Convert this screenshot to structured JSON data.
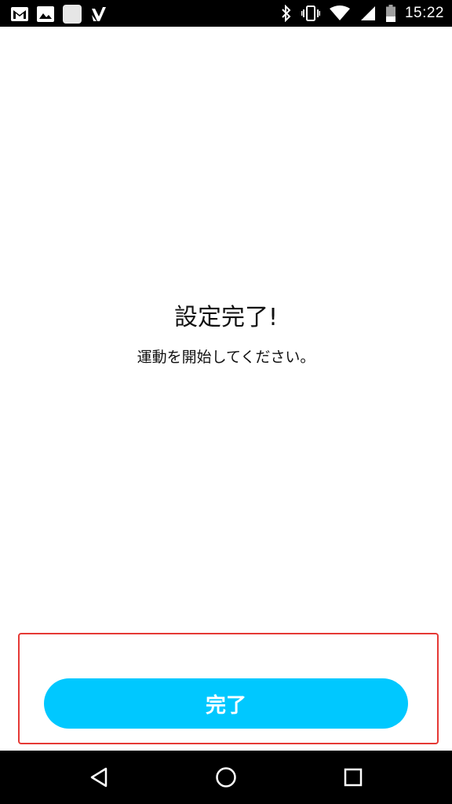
{
  "status_bar": {
    "time": "15:22",
    "left_icons": [
      "gmail-icon",
      "gallery-icon",
      "square-app-icon",
      "check-app-icon"
    ],
    "right_icons": [
      "bluetooth-icon",
      "vibrate-icon",
      "wifi-icon",
      "signal-icon",
      "battery-icon"
    ]
  },
  "content": {
    "title": "設定完了!",
    "subtitle": "運動を開始してください。"
  },
  "actions": {
    "done_label": "完了"
  },
  "nav_bar": {
    "icons": [
      "back-icon",
      "home-icon",
      "recents-icon"
    ]
  },
  "colors": {
    "accent": "#00c8ff",
    "highlight_border": "#e53935",
    "bar_background": "#000000"
  }
}
